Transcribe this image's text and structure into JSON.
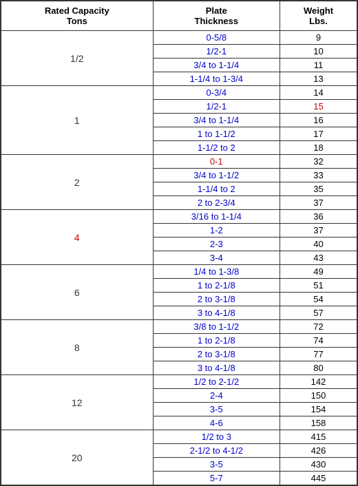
{
  "headers": {
    "col1": "Rated Capacity\nTons",
    "col2": "Plate\nThickness",
    "col3": "Weight\nLbs."
  },
  "groups": [
    {
      "capacity": "1/2",
      "capacity_color": "normal",
      "rows": [
        {
          "plate": "0-5/8",
          "plate_color": "blue",
          "weight": "9",
          "weight_color": "normal"
        },
        {
          "plate": "1/2-1",
          "plate_color": "blue",
          "weight": "10",
          "weight_color": "normal"
        },
        {
          "plate": "3/4 to 1-1/4",
          "plate_color": "blue",
          "weight": "11",
          "weight_color": "normal"
        },
        {
          "plate": "1-1/4 to 1-3/4",
          "plate_color": "blue",
          "weight": "13",
          "weight_color": "normal"
        }
      ]
    },
    {
      "capacity": "1",
      "capacity_color": "normal",
      "rows": [
        {
          "plate": "0-3/4",
          "plate_color": "blue",
          "weight": "14",
          "weight_color": "normal"
        },
        {
          "plate": "1/2-1",
          "plate_color": "blue",
          "weight": "15",
          "weight_color": "red"
        },
        {
          "plate": "3/4 to 1-1/4",
          "plate_color": "blue",
          "weight": "16",
          "weight_color": "normal"
        },
        {
          "plate": "1 to 1-1/2",
          "plate_color": "blue",
          "weight": "17",
          "weight_color": "normal"
        },
        {
          "plate": "1-1/2 to 2",
          "plate_color": "blue",
          "weight": "18",
          "weight_color": "normal"
        }
      ]
    },
    {
      "capacity": "2",
      "capacity_color": "normal",
      "rows": [
        {
          "plate": "0-1",
          "plate_color": "red",
          "weight": "32",
          "weight_color": "normal"
        },
        {
          "plate": "3/4 to 1-1/2",
          "plate_color": "blue",
          "weight": "33",
          "weight_color": "normal"
        },
        {
          "plate": "1-1/4 to 2",
          "plate_color": "blue",
          "weight": "35",
          "weight_color": "normal"
        },
        {
          "plate": "2 to 2-3/4",
          "plate_color": "blue",
          "weight": "37",
          "weight_color": "normal"
        }
      ]
    },
    {
      "capacity": "4",
      "capacity_color": "red",
      "rows": [
        {
          "plate": "3/16 to 1-1/4",
          "plate_color": "blue",
          "weight": "36",
          "weight_color": "normal"
        },
        {
          "plate": "1-2",
          "plate_color": "blue",
          "weight": "37",
          "weight_color": "normal"
        },
        {
          "plate": "2-3",
          "plate_color": "blue",
          "weight": "40",
          "weight_color": "normal"
        },
        {
          "plate": "3-4",
          "plate_color": "blue",
          "weight": "43",
          "weight_color": "normal"
        }
      ]
    },
    {
      "capacity": "6",
      "capacity_color": "normal",
      "rows": [
        {
          "plate": "1/4 to 1-3/8",
          "plate_color": "blue",
          "weight": "49",
          "weight_color": "normal"
        },
        {
          "plate": "1 to 2-1/8",
          "plate_color": "blue",
          "weight": "51",
          "weight_color": "normal"
        },
        {
          "plate": "2 to 3-1/8",
          "plate_color": "blue",
          "weight": "54",
          "weight_color": "normal"
        },
        {
          "plate": "3 to 4-1/8",
          "plate_color": "blue",
          "weight": "57",
          "weight_color": "normal"
        }
      ]
    },
    {
      "capacity": "8",
      "capacity_color": "normal",
      "rows": [
        {
          "plate": "3/8 to 1-1/2",
          "plate_color": "blue",
          "weight": "72",
          "weight_color": "normal"
        },
        {
          "plate": "1 to 2-1/8",
          "plate_color": "blue",
          "weight": "74",
          "weight_color": "normal"
        },
        {
          "plate": "2 to 3-1/8",
          "plate_color": "blue",
          "weight": "77",
          "weight_color": "normal"
        },
        {
          "plate": "3 to 4-1/8",
          "plate_color": "blue",
          "weight": "80",
          "weight_color": "normal"
        }
      ]
    },
    {
      "capacity": "12",
      "capacity_color": "normal",
      "rows": [
        {
          "plate": "1/2 to 2-1/2",
          "plate_color": "blue",
          "weight": "142",
          "weight_color": "normal"
        },
        {
          "plate": "2-4",
          "plate_color": "blue",
          "weight": "150",
          "weight_color": "normal"
        },
        {
          "plate": "3-5",
          "plate_color": "blue",
          "weight": "154",
          "weight_color": "normal"
        },
        {
          "plate": "4-6",
          "plate_color": "blue",
          "weight": "158",
          "weight_color": "normal"
        }
      ]
    },
    {
      "capacity": "20",
      "capacity_color": "normal",
      "rows": [
        {
          "plate": "1/2 to 3",
          "plate_color": "blue",
          "weight": "415",
          "weight_color": "normal"
        },
        {
          "plate": "2-1/2 to 4-1/2",
          "plate_color": "blue",
          "weight": "426",
          "weight_color": "normal"
        },
        {
          "plate": "3-5",
          "plate_color": "blue",
          "weight": "430",
          "weight_color": "normal"
        },
        {
          "plate": "5-7",
          "plate_color": "blue",
          "weight": "445",
          "weight_color": "normal"
        }
      ]
    }
  ]
}
